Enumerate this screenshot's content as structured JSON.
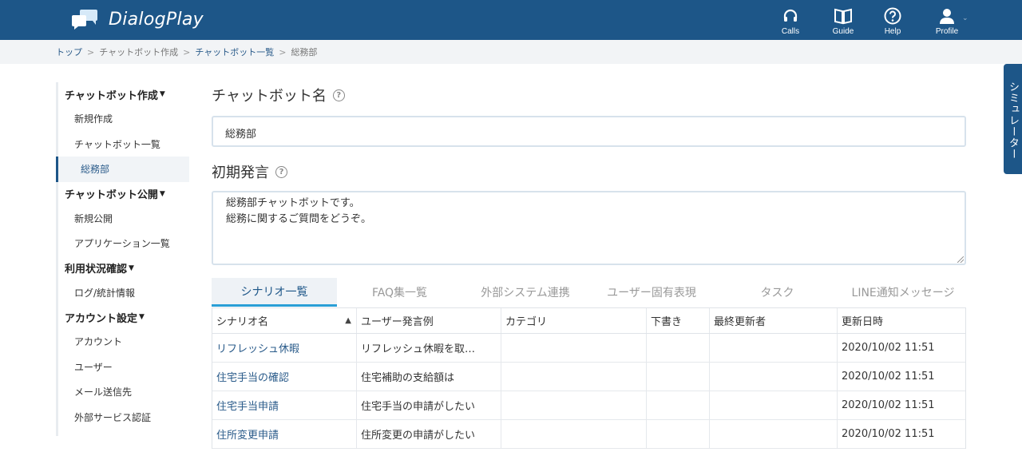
{
  "header": {
    "logo_text": "DialogPlay",
    "nav": [
      {
        "label": "Calls",
        "icon": "headset-icon"
      },
      {
        "label": "Guide",
        "icon": "book-icon"
      },
      {
        "label": "Help",
        "icon": "question-icon"
      },
      {
        "label": "Profile",
        "icon": "user-icon"
      }
    ],
    "color": "#1d5688"
  },
  "breadcrumb": [
    "トップ",
    "チャットボット作成",
    "チャットボット一覧",
    "総務部"
  ],
  "sidebar": {
    "sections": [
      {
        "title": "チャットボット作成",
        "items": [
          "新規作成",
          "チャットボット一覧",
          "総務部"
        ]
      },
      {
        "title": "チャットボット公開",
        "items": [
          "新規公開",
          "アプリケーション一覧"
        ]
      },
      {
        "title": "利用状況確認",
        "items": [
          "ログ/統計情報"
        ]
      },
      {
        "title": "アカウント設定",
        "items": [
          "アカウント",
          "ユーザー",
          "メール送信先",
          "外部サービス認証"
        ]
      }
    ],
    "active_item": "総務部"
  },
  "form": {
    "name_label": "チャットボット名",
    "name_value": "総務部",
    "greeting_label": "初期発言",
    "greeting_lines": [
      "総務部チャットボットです。",
      "総務に関するご質問をどうぞ。"
    ]
  },
  "tabs": [
    "シナリオ一覧",
    "FAQ集一覧",
    "外部システム連携",
    "ユーザー固有表現",
    "タスク",
    "LINE通知メッセージ"
  ],
  "active_tab": "シナリオ一覧",
  "table": {
    "columns": [
      "シナリオ名",
      "ユーザー発言例",
      "カテゴリ",
      "下書き",
      "最終更新者",
      "更新日時"
    ],
    "sort_indicator": "▲",
    "rows": [
      [
        "リフレッシュ休暇",
        "リフレッシュ休暇を取…",
        "",
        "",
        "",
        "2020/10/02 11:51"
      ],
      [
        "住宅手当の確認",
        "住宅補助の支給額は",
        "",
        "",
        "",
        "2020/10/02 11:51"
      ],
      [
        "住宅手当申請",
        "住宅手当の申請がしたい",
        "",
        "",
        "",
        "2020/10/02 11:51"
      ],
      [
        "住所変更申請",
        "住所変更の申請がしたい",
        "",
        "",
        "",
        "2020/10/02 11:51"
      ]
    ]
  },
  "simulator_label": "シミュレーター"
}
